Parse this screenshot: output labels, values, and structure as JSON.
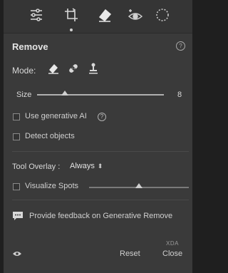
{
  "toolbar": {
    "tools": [
      {
        "name": "edit-sliders-icon"
      },
      {
        "name": "crop-icon",
        "active": true
      },
      {
        "name": "remove-eraser-icon"
      },
      {
        "name": "red-eye-icon"
      },
      {
        "name": "masking-icon"
      }
    ]
  },
  "panel": {
    "title": "Remove",
    "mode_label": "Mode:",
    "size_label": "Size",
    "size_value": "8",
    "size_fraction": 0.22,
    "generative_ai_label": "Use generative AI",
    "detect_objects_label": "Detect objects",
    "tool_overlay_label": "Tool Overlay :",
    "tool_overlay_value": "Always",
    "visualize_spots_label": "Visualize Spots",
    "visualize_fraction": 0.5,
    "feedback_text": "Provide feedback on Generative Remove",
    "reset_label": "Reset",
    "close_label": "Close",
    "watermark": "XDA"
  },
  "colors": {
    "panel_bg": "#3a3a3a",
    "toolbar_bg": "#353535",
    "text": "#d8d8d8"
  }
}
